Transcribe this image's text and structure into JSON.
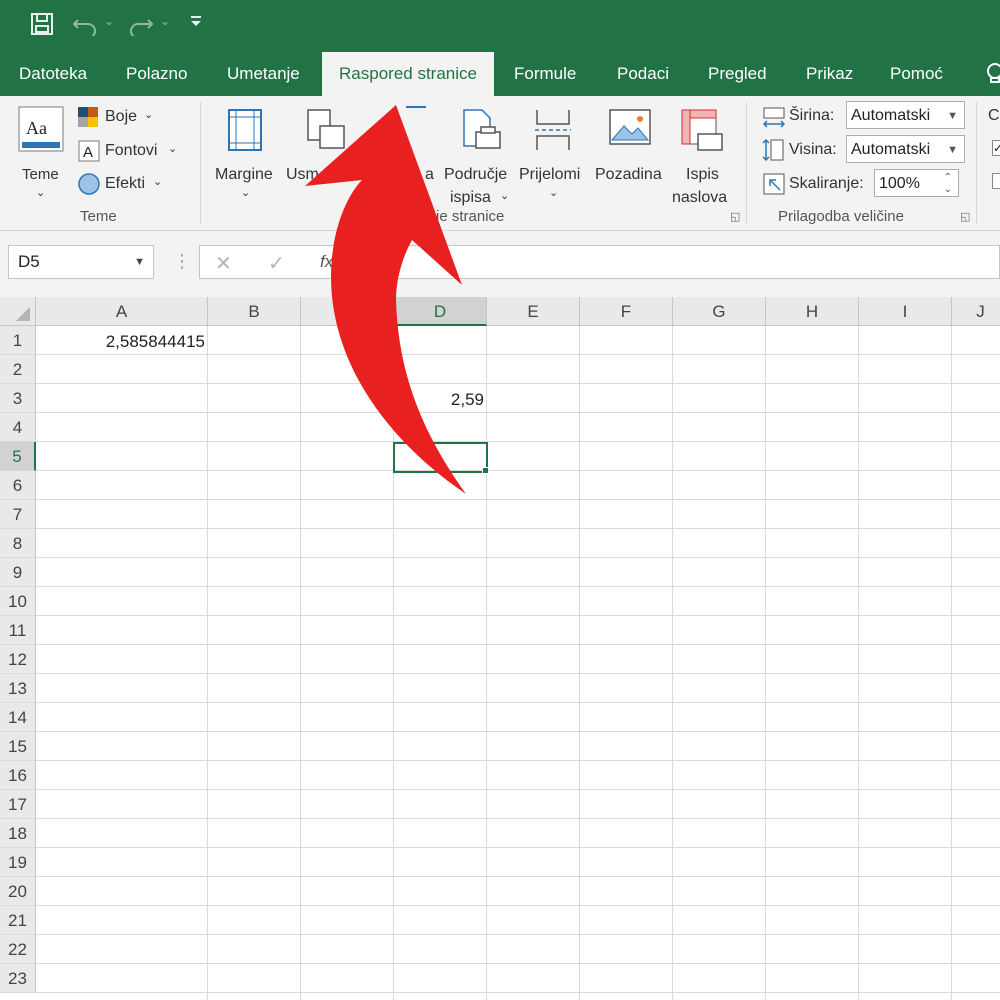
{
  "tabs": [
    {
      "label": "Datoteka"
    },
    {
      "label": "Polazno"
    },
    {
      "label": "Umetanje"
    },
    {
      "label": "Raspored stranice",
      "active": true
    },
    {
      "label": "Formule"
    },
    {
      "label": "Podaci"
    },
    {
      "label": "Pregled"
    },
    {
      "label": "Prikaz"
    },
    {
      "label": "Pomoć"
    }
  ],
  "ribbon": {
    "teme": {
      "big_label": "Teme",
      "boje": "Boje",
      "fontovi": "Fontovi",
      "efekti": "Efekti",
      "group": "Teme"
    },
    "page_setup": {
      "margine": "Margine",
      "usmjerenje_partial": "Usm",
      "velicina_partial": "a",
      "podrucje_line1": "Područje",
      "podrucje_line2": "ispisa",
      "prijelomi": "Prijelomi",
      "pozadina": "Pozadina",
      "ispis_line1": "Ispis",
      "ispis_line2": "naslova",
      "group": "janje stranice",
      "group_prefix": "P"
    },
    "scale": {
      "sirina_label": "Širina:",
      "sirina_value": "Automatski",
      "visina_label": "Visina:",
      "visina_value": "Automatski",
      "skaliranje_label": "Skaliranje:",
      "skaliranje_value": "100%",
      "group": "Prilagodba veličine"
    },
    "cutoff_letter": "C"
  },
  "formula_bar": {
    "name_box": "D5",
    "formula_value": ""
  },
  "grid": {
    "columns": [
      "A",
      "B",
      "C",
      "D",
      "E",
      "F",
      "G",
      "H",
      "I",
      "J"
    ],
    "rows": [
      "1",
      "2",
      "3",
      "4",
      "5",
      "6",
      "7",
      "8",
      "9",
      "10",
      "11",
      "12",
      "13",
      "14",
      "15",
      "16",
      "17",
      "18",
      "19",
      "20",
      "21",
      "22",
      "23"
    ],
    "selected_column": "D",
    "selected_row": "5",
    "cells": {
      "A1": "2,585844415",
      "D3": "2,59"
    }
  },
  "annotation": {
    "arrow_color": "#e8201f"
  }
}
